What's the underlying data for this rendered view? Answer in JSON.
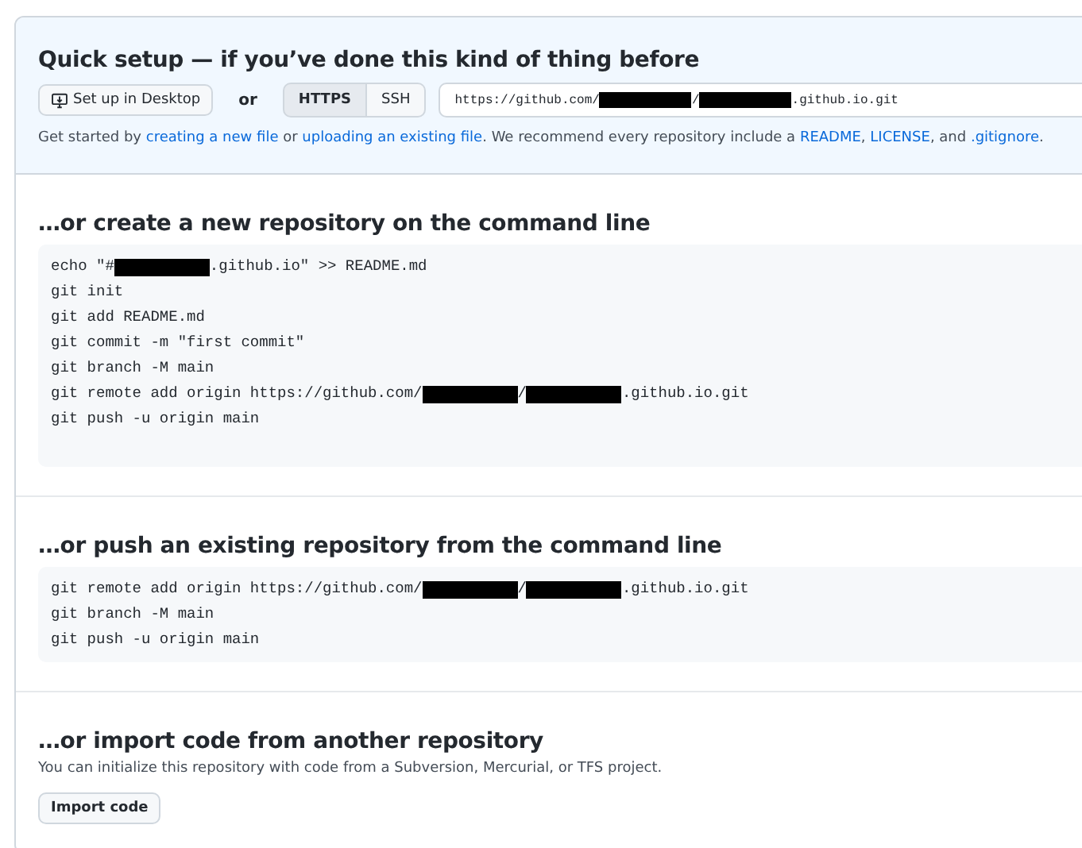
{
  "quick_setup": {
    "title": "Quick setup — if you’ve done this kind of thing before",
    "desktop_button": "Set up in Desktop",
    "or_label": "or",
    "protocols": [
      {
        "label": "HTTPS",
        "selected": true
      },
      {
        "label": "SSH",
        "selected": false
      }
    ],
    "clone_url": [
      {
        "kind": "text",
        "text": "https://github.com/"
      },
      {
        "kind": "redacted"
      },
      {
        "kind": "text",
        "text": "/"
      },
      {
        "kind": "redacted"
      },
      {
        "kind": "text",
        "text": ".github.io.git"
      }
    ],
    "hint": [
      {
        "kind": "text",
        "text": "Get started by "
      },
      {
        "kind": "link",
        "text": "creating a new file"
      },
      {
        "kind": "text",
        "text": " or "
      },
      {
        "kind": "link",
        "text": "uploading an existing file"
      },
      {
        "kind": "text",
        "text": ". We recommend every repository include a "
      },
      {
        "kind": "link",
        "text": "README"
      },
      {
        "kind": "text",
        "text": ", "
      },
      {
        "kind": "link",
        "text": "LICENSE"
      },
      {
        "kind": "text",
        "text": ", and "
      },
      {
        "kind": "link",
        "text": ".gitignore"
      },
      {
        "kind": "text",
        "text": "."
      }
    ]
  },
  "sections": [
    {
      "kind": "code",
      "title": "…or create a new repository on the command line",
      "tall": true,
      "lines": [
        [
          {
            "kind": "text",
            "text": "echo \"#"
          },
          {
            "kind": "redacted"
          },
          {
            "kind": "text",
            "text": ".github.io\" >> README.md"
          }
        ],
        [
          {
            "kind": "text",
            "text": "git init"
          }
        ],
        [
          {
            "kind": "text",
            "text": "git add README.md"
          }
        ],
        [
          {
            "kind": "text",
            "text": "git commit -m \"first commit\""
          }
        ],
        [
          {
            "kind": "text",
            "text": "git branch -M main"
          }
        ],
        [
          {
            "kind": "text",
            "text": "git remote add origin https://github.com/"
          },
          {
            "kind": "redacted"
          },
          {
            "kind": "text",
            "text": "/"
          },
          {
            "kind": "redacted"
          },
          {
            "kind": "text",
            "text": ".github.io.git"
          }
        ],
        [
          {
            "kind": "text",
            "text": "git push -u origin main"
          }
        ]
      ]
    },
    {
      "kind": "code",
      "title": "…or push an existing repository from the command line",
      "tall": false,
      "lines": [
        [
          {
            "kind": "text",
            "text": "git remote add origin https://github.com/"
          },
          {
            "kind": "redacted"
          },
          {
            "kind": "text",
            "text": "/"
          },
          {
            "kind": "redacted"
          },
          {
            "kind": "text",
            "text": ".github.io.git"
          }
        ],
        [
          {
            "kind": "text",
            "text": "git branch -M main"
          }
        ],
        [
          {
            "kind": "text",
            "text": "git push -u origin main"
          }
        ]
      ]
    },
    {
      "kind": "import",
      "title": "…or import code from another repository",
      "text": "You can initialize this repository with code from a Subversion, Mercurial, or TFS project.",
      "button": "Import code"
    }
  ]
}
